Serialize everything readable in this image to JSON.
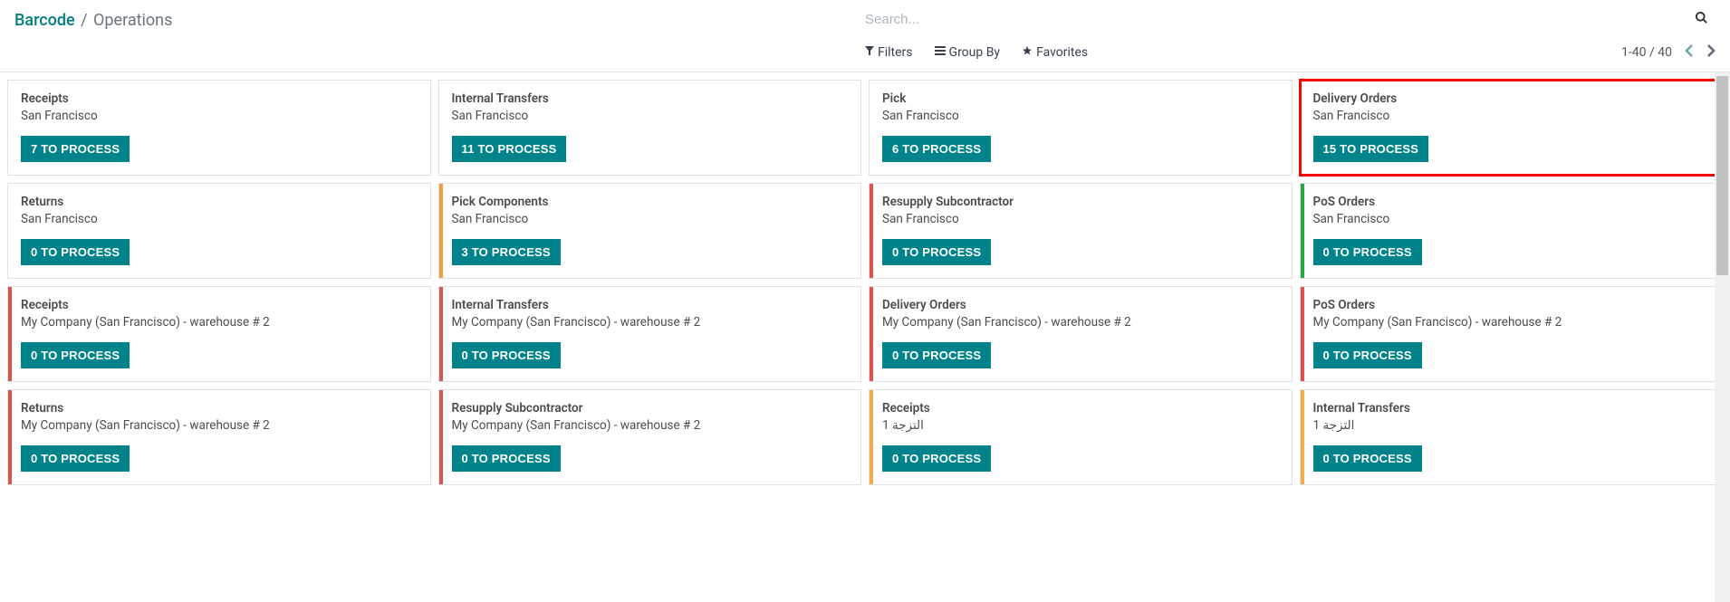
{
  "breadcrumb": {
    "root": "Barcode",
    "current": "Operations"
  },
  "search": {
    "placeholder": "Search..."
  },
  "toolbar": {
    "filters": "Filters",
    "group_by": "Group By",
    "favorites": "Favorites"
  },
  "pager": {
    "range": "1-40",
    "sep": "/",
    "total": "40"
  },
  "button_template": "{n} TO PROCESS",
  "stripe_colors": {
    "orange": "#f29d3a",
    "red": "#d9534f",
    "green": "#28a745",
    "yellow": "#f0ad4e"
  },
  "cards": [
    {
      "title": "Receipts",
      "subtitle": "San Francisco",
      "count": 7,
      "stripe": null,
      "highlight": false
    },
    {
      "title": "Internal Transfers",
      "subtitle": "San Francisco",
      "count": 11,
      "stripe": null,
      "highlight": false
    },
    {
      "title": "Pick",
      "subtitle": "San Francisco",
      "count": 6,
      "stripe": null,
      "highlight": false
    },
    {
      "title": "Delivery Orders",
      "subtitle": "San Francisco",
      "count": 15,
      "stripe": null,
      "highlight": true
    },
    {
      "title": "Returns",
      "subtitle": "San Francisco",
      "count": 0,
      "stripe": null,
      "highlight": false
    },
    {
      "title": "Pick Components",
      "subtitle": "San Francisco",
      "count": 3,
      "stripe": "orange",
      "highlight": false
    },
    {
      "title": "Resupply Subcontractor",
      "subtitle": "San Francisco",
      "count": 0,
      "stripe": "red",
      "highlight": false
    },
    {
      "title": "PoS Orders",
      "subtitle": "San Francisco",
      "count": 0,
      "stripe": "green",
      "highlight": false
    },
    {
      "title": "Receipts",
      "subtitle": "My Company (San Francisco) - warehouse # 2",
      "count": 0,
      "stripe": "red",
      "highlight": false
    },
    {
      "title": "Internal Transfers",
      "subtitle": "My Company (San Francisco) - warehouse # 2",
      "count": 0,
      "stripe": "red",
      "highlight": false
    },
    {
      "title": "Delivery Orders",
      "subtitle": "My Company (San Francisco) - warehouse # 2",
      "count": 0,
      "stripe": "red",
      "highlight": false
    },
    {
      "title": "PoS Orders",
      "subtitle": "My Company (San Francisco) - warehouse # 2",
      "count": 0,
      "stripe": "red",
      "highlight": false
    },
    {
      "title": "Returns",
      "subtitle": "My Company (San Francisco) - warehouse # 2",
      "count": 0,
      "stripe": "red",
      "highlight": false
    },
    {
      "title": "Resupply Subcontractor",
      "subtitle": "My Company (San Francisco) - warehouse # 2",
      "count": 0,
      "stripe": "red",
      "highlight": false
    },
    {
      "title": "Receipts",
      "subtitle": "التزجة 1",
      "count": 0,
      "stripe": "yellow",
      "highlight": false
    },
    {
      "title": "Internal Transfers",
      "subtitle": "التزجة 1",
      "count": 0,
      "stripe": "yellow",
      "highlight": false
    }
  ]
}
